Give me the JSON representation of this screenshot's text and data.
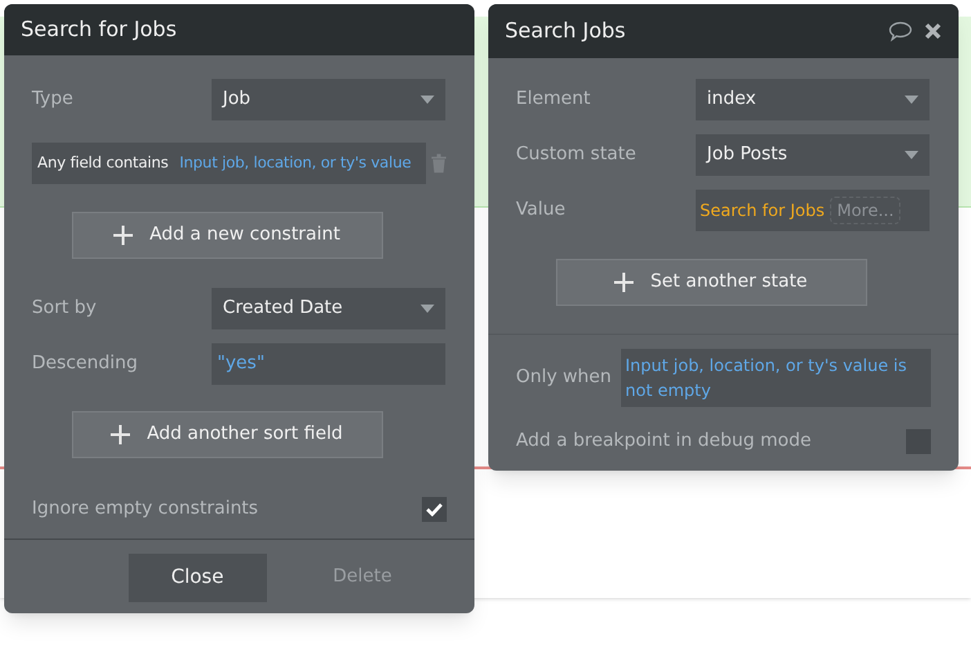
{
  "search_panel": {
    "title": "Search for Jobs",
    "type": {
      "label": "Type",
      "value": "Job"
    },
    "constraint": {
      "label": "Any field contains",
      "value": "Input job, location, or ty's value"
    },
    "add_constraint_button": "Add a new constraint",
    "sort_by": {
      "label": "Sort by",
      "value": "Created Date"
    },
    "descending": {
      "label": "Descending",
      "value": "\"yes\""
    },
    "add_sort_button": "Add another sort field",
    "ignore_empty": {
      "label": "Ignore empty constraints",
      "checked": true
    },
    "close_button": "Close",
    "delete_button": {
      "label": "Delete",
      "disabled": true
    }
  },
  "action_panel": {
    "title": "Search Jobs",
    "fields": [
      {
        "kind": "dropdown",
        "label": "Element",
        "value": "index"
      },
      {
        "kind": "dropdown",
        "label": "Custom state",
        "value": "Job Posts"
      },
      {
        "kind": "expression",
        "label": "Value",
        "value": "Search for Jobs",
        "more": "More..."
      }
    ],
    "set_state_button": "Set another state",
    "only_when": {
      "label": "Only when",
      "value": "Input job, location, or ty's value is not empty"
    },
    "breakpoint": {
      "label": "Add a breakpoint in debug mode",
      "checked": false
    }
  }
}
